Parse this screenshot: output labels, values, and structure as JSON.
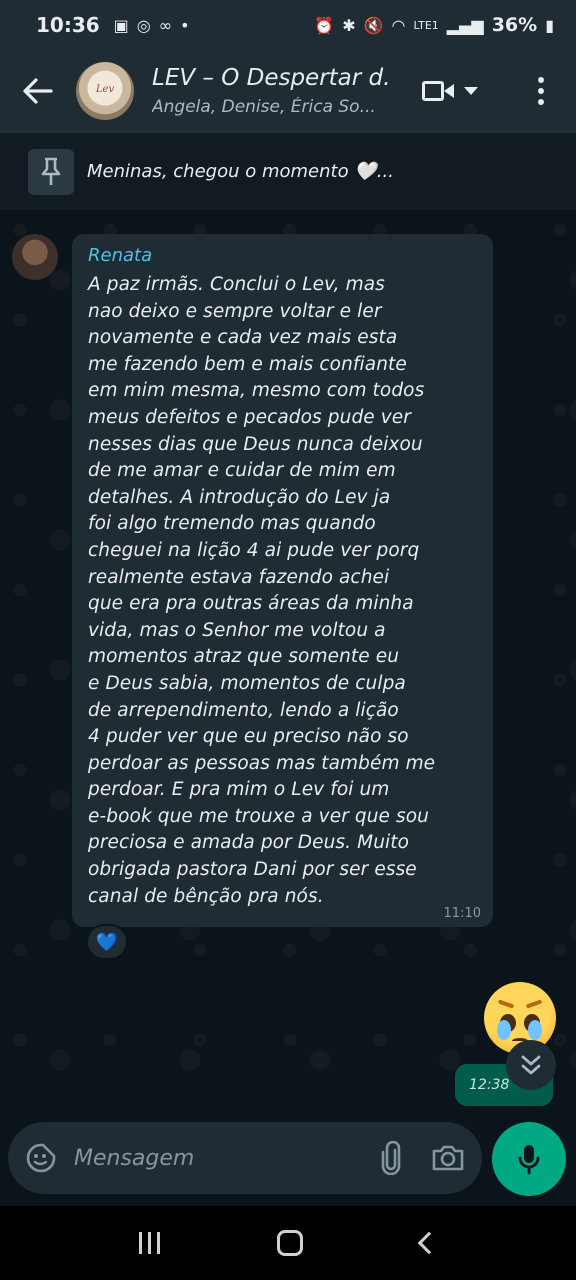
{
  "status_bar": {
    "time": "10:36",
    "battery": "36%",
    "network": "LTE1"
  },
  "header": {
    "title": "LEV – O Despertar d...",
    "subtitle": "Angela, Denise, Érica So...",
    "avatar_text": "Lev"
  },
  "pinned": {
    "text": "Meninas, chegou o momento 🤍..."
  },
  "message": {
    "sender": "Renata",
    "text": "A paz irmãs. Conclui o Lev, mas\nnao deixo e sempre voltar e ler\nnovamente e cada vez mais esta\nme fazendo bem e mais confiante\nem mim mesma, mesmo com todos\nmeus defeitos e  pecados pude ver\nnesses dias que Deus nunca deixou\nde me amar e cuidar de mim em\ndetalhes. A introdução do Lev ja\nfoi algo tremendo mas  quando\ncheguei na lição 4 ai pude ver porq\nrealmente estava fazendo achei\nque era pra outras áreas da minha\nvida, mas o Senhor me voltou a\nmomentos atraz que somente eu\ne Deus sabia, momentos de culpa\nde arrependimento,  lendo a lição\n4 puder ver que eu preciso não so\nperdoar as pessoas mas também me\nperdoar. E pra mim o Lev foi  um\ne-book que me trouxe a ver que sou\npreciosa e amada por Deus. Muito\nobrigada pastora Dani por ser esse\ncanal de bênção pra nós.",
    "time": "11:10",
    "reaction": "💙"
  },
  "my_message": {
    "time": "12:38"
  },
  "input": {
    "placeholder": "Mensagem"
  },
  "colors": {
    "accent": "#00a884",
    "sender_name": "#53bdeb",
    "outgoing_bubble": "#005c4b"
  }
}
